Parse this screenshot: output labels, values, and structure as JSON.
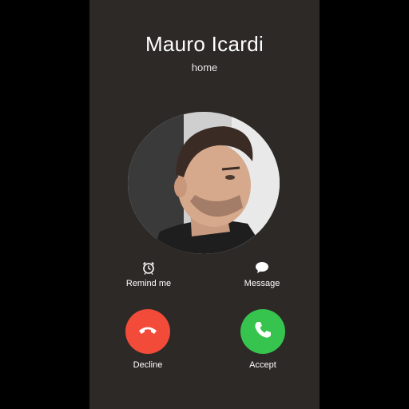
{
  "call": {
    "caller_name": "Mauro Icardi",
    "caller_label": "home"
  },
  "actions": {
    "remind": {
      "label": "Remind me",
      "icon": "alarm-clock-icon"
    },
    "message": {
      "label": "Message",
      "icon": "speech-bubble-icon"
    },
    "decline": {
      "label": "Decline",
      "icon": "phone-hangup-icon",
      "color": "#f24b3a"
    },
    "accept": {
      "label": "Accept",
      "icon": "phone-icon",
      "color": "#36c44f"
    }
  },
  "colors": {
    "screen_background": "#2c2926",
    "outer_background": "#000000"
  }
}
